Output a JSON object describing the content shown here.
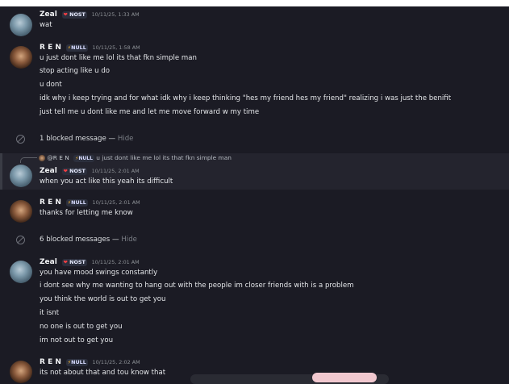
{
  "messages": [
    {
      "author": "Zeal",
      "badge_icon": "heart-icon",
      "badge": "NOST",
      "timestamp": "10/11/25, 1:33 AM",
      "lines": [
        "wat"
      ]
    },
    {
      "author": "R E N",
      "badge_icon": "lightning-icon",
      "badge": "NULL",
      "timestamp": "10/11/25, 1:58 AM",
      "lines": [
        "u just dont like me lol its that fkn simple man",
        "stop acting like u do",
        "u dont",
        "idk why i keep trying and for what idk why i keep thinking \"hes my friend hes my friend\" realizing i was just the benifit",
        "just tell me u dont like me and let me move forward w my time"
      ]
    },
    {
      "author": "Zeal",
      "badge": "NOST",
      "timestamp": "10/11/25, 2:01 AM",
      "reply_to": {
        "author": "@R E N",
        "badge": "NULL",
        "text": "u just dont like me lol its that fkn simple man"
      },
      "lines": [
        "when you act like this yeah its difficult"
      ]
    },
    {
      "author": "R E N",
      "badge": "NULL",
      "timestamp": "10/11/25, 2:01 AM",
      "lines": [
        "thanks for letting me know"
      ]
    },
    {
      "author": "Zeal",
      "badge": "NOST",
      "timestamp": "10/11/25, 2:01 AM",
      "lines": [
        "you have mood swings constantly",
        "i dont see why me wanting to hang out with the people im closer friends with is a problem",
        "you think the world is out to get you",
        "it isnt",
        "no one is out to get you",
        "im not out to get you"
      ]
    },
    {
      "author": "R E N",
      "badge": "NULL",
      "timestamp": "10/11/25, 2:02 AM",
      "lines": [
        "its not about that and tou know that"
      ]
    }
  ],
  "blocked": [
    {
      "text": "1 blocked message",
      "separator": " — ",
      "action": "Hide"
    },
    {
      "text": "6 blocked messages",
      "separator": " — ",
      "action": "Hide"
    }
  ],
  "colors": {
    "background": "#1b1b24",
    "username": "#f2f3f5",
    "nost_heart": "#f23f43",
    "null_bolt": "#f0b232",
    "hide_link": "#7b7f86"
  }
}
